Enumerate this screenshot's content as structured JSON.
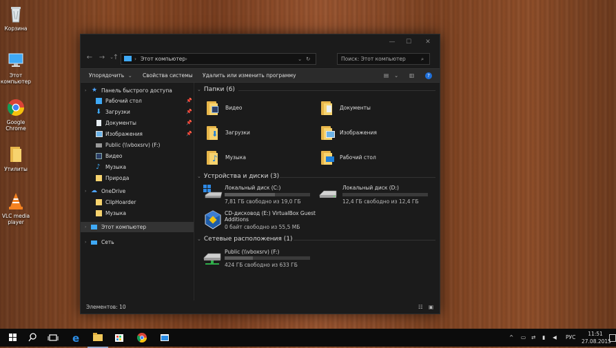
{
  "desktop": {
    "icons": [
      {
        "name": "recycle-bin",
        "label": "Корзина"
      },
      {
        "name": "this-pc",
        "label": "Этот компьютер"
      },
      {
        "name": "google-chrome",
        "label": "Google Chrome"
      },
      {
        "name": "utilities",
        "label": "Утилиты"
      },
      {
        "name": "vlc",
        "label": "VLC media player"
      }
    ]
  },
  "window": {
    "address": "Этот компьютер",
    "search_placeholder": "Поиск: Этот компьютер",
    "toolbar": {
      "organize": "Упорядочить",
      "properties": "Свойства системы",
      "uninstall": "Удалить или изменить программу"
    },
    "nav": {
      "quick_access": "Панель быстрого доступа",
      "items": [
        {
          "label": "Рабочий стол",
          "pinned": true
        },
        {
          "label": "Загрузки",
          "pinned": true
        },
        {
          "label": "Документы",
          "pinned": true
        },
        {
          "label": "Изображения",
          "pinned": true
        },
        {
          "label": "Public (\\\\vboxsrv) (F:)",
          "pinned": false
        },
        {
          "label": "Видео",
          "pinned": false
        },
        {
          "label": "Музыка",
          "pinned": false
        },
        {
          "label": "Природа",
          "pinned": false
        }
      ],
      "onedrive": "OneDrive",
      "onedrive_items": [
        "ClipHoarder",
        "Музыка"
      ],
      "this_pc": "Этот компьютер",
      "network": "Сеть"
    },
    "sections": {
      "folders": "Папки (6)",
      "devices": "Устройства и диски (3)",
      "network": "Сетевые расположения (1)"
    },
    "folders": [
      {
        "label": "Видео",
        "overlay": "video"
      },
      {
        "label": "Документы",
        "overlay": "documents"
      },
      {
        "label": "Загрузки",
        "overlay": "downloads"
      },
      {
        "label": "Изображения",
        "overlay": "pictures"
      },
      {
        "label": "Музыка",
        "overlay": "music"
      },
      {
        "label": "Рабочий стол",
        "overlay": "desktop"
      }
    ],
    "drives": [
      {
        "name": "Локальный диск (C:)",
        "info": "7,81 ГБ свободно из 19,0 ГБ",
        "used_fraction": 0.59
      },
      {
        "name": "Локальный диск (D:)",
        "info": "12,4 ГБ свободно из 12,4 ГБ",
        "used_fraction": 0.0
      },
      {
        "name": "CD-дисковод (E:) VirtualBox Guest",
        "name2": "Additions",
        "info": "0 байт свободно из 55,5 МБ",
        "used_fraction": 1.0
      }
    ],
    "network_locations": [
      {
        "name": "Public (\\\\vboxsrv) (F:)",
        "info": "424 ГБ свободно из 633 ГБ",
        "used_fraction": 0.33
      }
    ],
    "status": "Элементов: 10"
  },
  "taskbar": {
    "language": "РУС",
    "time": "11:51",
    "date": "27.08.2015"
  },
  "colors": {
    "folder": "#f7d36e",
    "accent": "#1e90ff",
    "window_bg": "#1b1b1b"
  }
}
